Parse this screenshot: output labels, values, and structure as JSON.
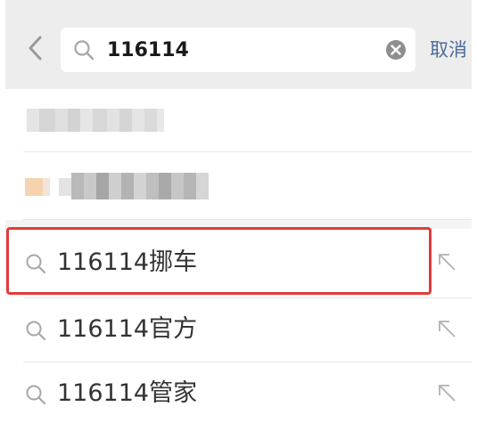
{
  "search": {
    "query": "116114",
    "cancel_label": "取消"
  },
  "suggestions": [
    {
      "label": "116114挪车"
    },
    {
      "label": "116114官方"
    },
    {
      "label": "116114管家"
    }
  ],
  "colors": {
    "header_bg": "#ededed",
    "cancel_text": "#4c6a9b",
    "highlight_border": "#e23b3b"
  },
  "icons": [
    "chevron-left-icon",
    "search-icon",
    "clear-icon",
    "fill-arrow-icon"
  ]
}
